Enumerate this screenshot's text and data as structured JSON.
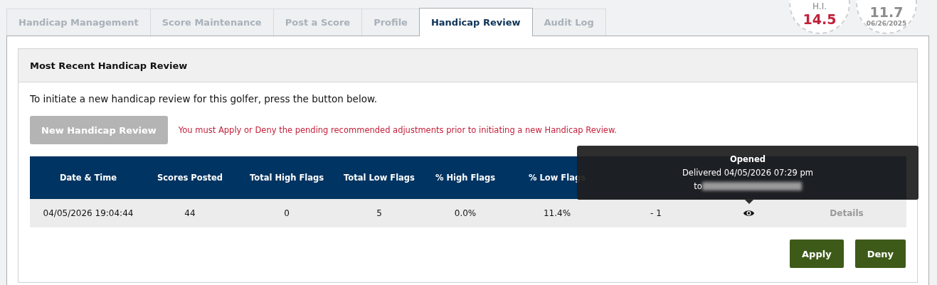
{
  "tabs": [
    {
      "label": "Handicap Management",
      "selected": false
    },
    {
      "label": "Score Maintenance",
      "selected": false
    },
    {
      "label": "Post a Score",
      "selected": false
    },
    {
      "label": "Profile",
      "selected": false
    },
    {
      "label": "Handicap Review",
      "selected": true
    },
    {
      "label": "Audit Log",
      "selected": false
    }
  ],
  "indexes": [
    {
      "label": "H.I.",
      "value": "14.5",
      "kind": "current"
    },
    {
      "value": "11.7",
      "date": "06/26/2025",
      "kind": "low"
    }
  ],
  "section": {
    "title": "Most Recent Handicap Review",
    "intro": "To initiate a new handicap review for this golfer, press the button below.",
    "new_review_button": {
      "label": "New Handicap Review",
      "disabled": true
    },
    "warning": "You must Apply or Deny the pending recommended adjustments prior to initiating a new Handicap Review."
  },
  "table": {
    "columns": [
      "Date & Time",
      "Scores Posted",
      "Total High Flags",
      "Total Low Flags",
      "% High Flags",
      "% Low Flags"
    ],
    "rows": [
      {
        "cells": [
          "04/05/2026 19:04:44",
          "44",
          "0",
          "5",
          "0.0%",
          "11.4%",
          "- 1"
        ],
        "details": "Details"
      }
    ]
  },
  "tooltip": {
    "title": "Opened",
    "line": "Delivered 04/05/2026 07:29 pm",
    "to": "to"
  },
  "buttons": [
    "Apply",
    "Deny"
  ]
}
